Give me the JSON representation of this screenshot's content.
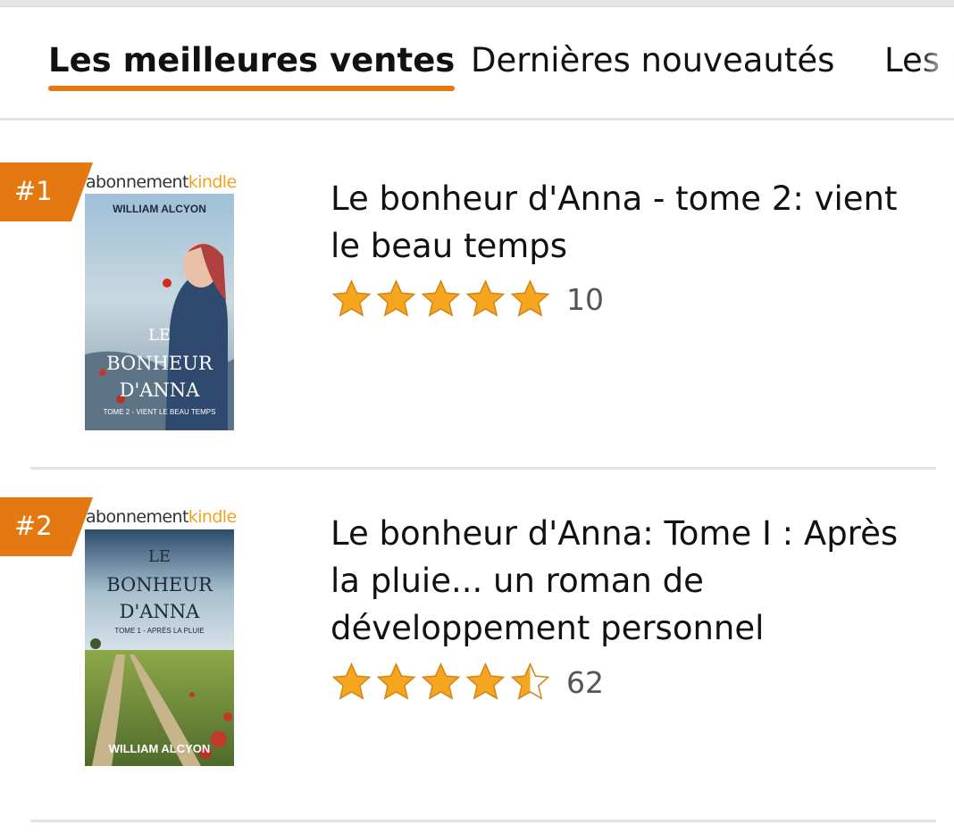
{
  "tabs": [
    {
      "label": "Les meilleures ventes",
      "active": true
    },
    {
      "label": "Dernières nouveautés",
      "active": false
    },
    {
      "label": "Les p",
      "active": false
    }
  ],
  "items": [
    {
      "rank": "#1",
      "badge_a": "abonnement",
      "badge_k": "kindle",
      "cover": {
        "author": "WILLIAM ALCYON",
        "line1": "LE",
        "line2": "BONHEUR",
        "line3": "D'ANNA",
        "subtitle": "TOME 2 - VIENT LE BEAU TEMPS"
      },
      "title": "Le bonheur d'Anna - tome 2: vient le beau temps",
      "rating": 5,
      "reviews": "10"
    },
    {
      "rank": "#2",
      "badge_a": "abonnement",
      "badge_k": "kindle",
      "cover": {
        "author": "WILLIAM ALCYON",
        "line1": "LE",
        "line2": "BONHEUR",
        "line3": "D'ANNA",
        "subtitle": "TOME 1 - APRÈS LA PLUIE"
      },
      "title": "Le bonheur d'Anna: Tome I : Après la pluie... un roman de développement personnel",
      "rating": 4.5,
      "reviews": "62"
    }
  ],
  "colors": {
    "accent": "#e47911",
    "star": "#f6a61e",
    "kindle": "#f0a21a"
  }
}
